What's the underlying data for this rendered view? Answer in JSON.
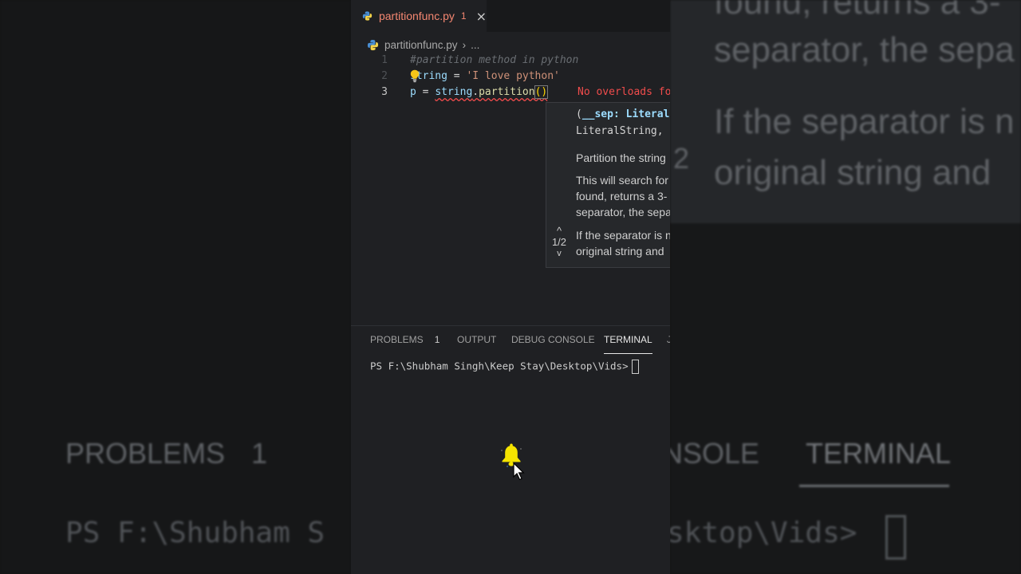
{
  "editor": {
    "tab": {
      "filename": "partitionfunc.py",
      "problem_count": "1",
      "close_icon": "×"
    },
    "breadcrumb": {
      "file": "partitionfunc.py",
      "separator": "›",
      "ellipsis": "..."
    },
    "code_lines": [
      {
        "number": "1",
        "text": "#partition method in python"
      },
      {
        "number": "2",
        "var": "string",
        "op": " = ",
        "str": "'I love python'"
      },
      {
        "number": "3",
        "var_p": "p",
        "op": " = ",
        "obj": "string",
        "dot": ".",
        "fn": "partition",
        "parens": "()"
      }
    ],
    "inline_error": "No overloads fo",
    "hover": {
      "signature_line1_open": "(",
      "signature_line1_kw": "__sep: Literal",
      "signature_line2": "LiteralString,",
      "summary": "Partition the string",
      "detail_1": "This will search for",
      "detail_2": "found, returns a 3-",
      "detail_3": "separator, the sepa",
      "detail_4": "If the separator is n",
      "detail_5": "original string and",
      "nav_up": "^",
      "nav_label": "1/2",
      "nav_down": "v"
    }
  },
  "panel": {
    "tabs": {
      "problems": "PROBLEMS",
      "problems_count": "1",
      "output": "OUTPUT",
      "debug_console": "DEBUG CONSOLE",
      "terminal": "TERMINAL",
      "more": "J"
    },
    "terminal_prompt": "PS F:\\Shubham Singh\\Keep Stay\\Desktop\\Vids>"
  },
  "background_blur": {
    "right_line_1": "found, returns a 3-",
    "right_line_2": "separator, the sepa",
    "right_line_3": "If the separator is n",
    "right_line_4": "original string and",
    "right_fragment": "2",
    "left_problems": "PROBLEMS",
    "left_count": "1",
    "right_console_fragment": "NSOLE",
    "right_terminal": "TERMINAL",
    "left_prompt": "PS F:\\Shubham S",
    "right_prompt": "sktop\\Vids>"
  },
  "colors": {
    "editor_bg": "#1f2023",
    "error_red": "#f14c4c",
    "tab_error": "#f48771",
    "string_orange": "#ce9178",
    "variable_blue": "#9cdcfe",
    "function_yellow": "#dcdcaa",
    "bell_yellow": "#f5e400"
  },
  "icons": {
    "tab_icon": "python-icon",
    "lightbulb": "lightbulb-icon",
    "bell": "bell-icon",
    "cursor": "mouse-pointer-icon"
  }
}
